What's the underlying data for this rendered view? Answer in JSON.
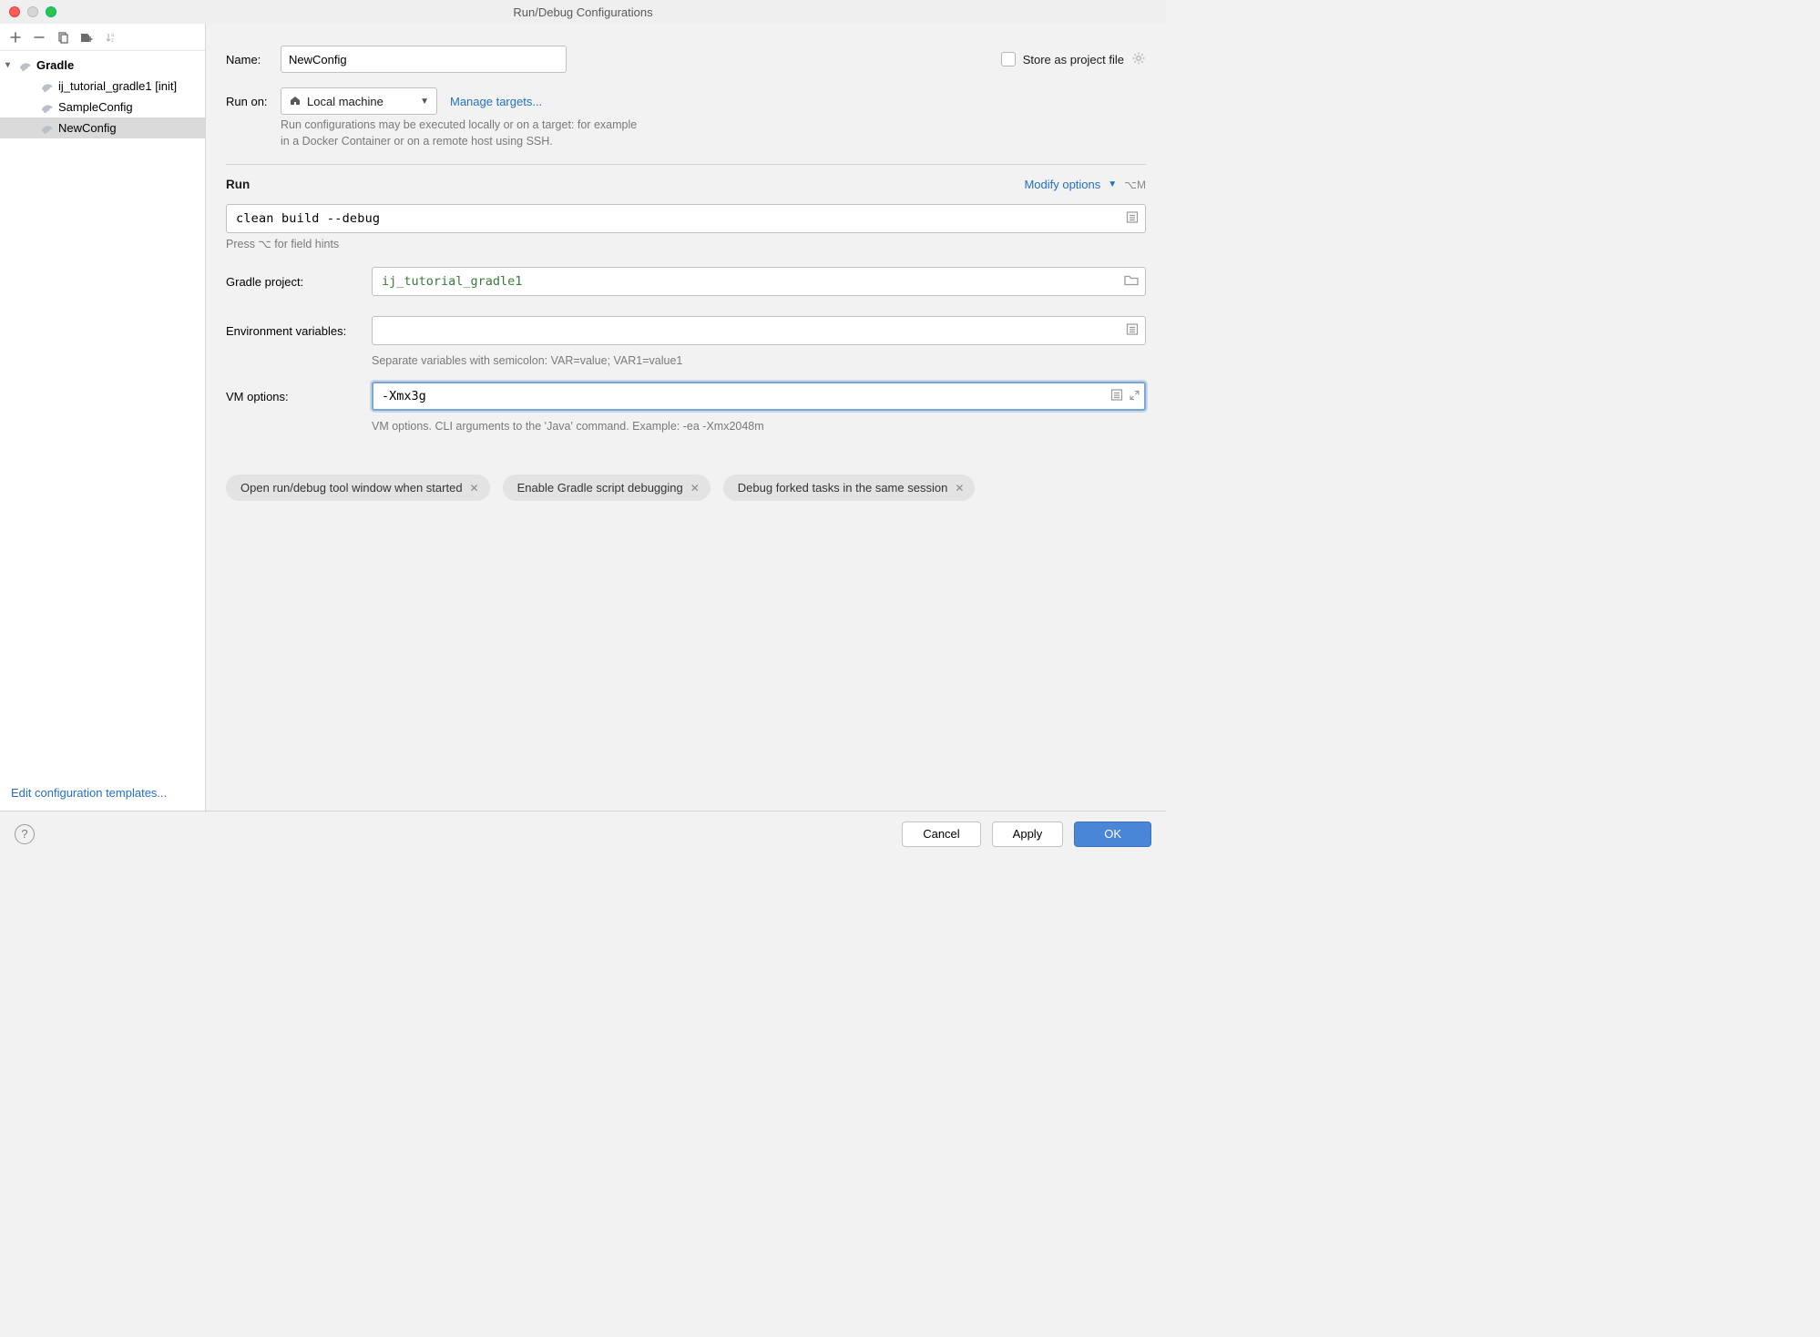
{
  "window": {
    "title": "Run/Debug Configurations"
  },
  "sidebar": {
    "toolbar_icons": [
      "add",
      "remove",
      "copy",
      "save",
      "sort"
    ],
    "group_label": "Gradle",
    "items": [
      {
        "label": "ij_tutorial_gradle1 [init]"
      },
      {
        "label": "SampleConfig"
      },
      {
        "label": "NewConfig"
      }
    ],
    "edit_templates_label": "Edit configuration templates..."
  },
  "form": {
    "name_label": "Name:",
    "name_value": "NewConfig",
    "store_label": "Store as project file",
    "runon_label": "Run on:",
    "runon_value": "Local machine",
    "manage_targets_label": "Manage targets...",
    "runon_hint_1": "Run configurations may be executed locally or on a target: for example",
    "runon_hint_2": "in a Docker Container or on a remote host using SSH."
  },
  "run": {
    "section_title": "Run",
    "modify_label": "Modify options",
    "modify_shortcut": "⌥M",
    "command_value": "clean build --debug",
    "command_hint": "Press ⌥ for field hints",
    "gradle_project_label": "Gradle project:",
    "gradle_project_value": "ij_tutorial_gradle1",
    "env_label": "Environment variables:",
    "env_value": "",
    "env_hint": "Separate variables with semicolon: VAR=value; VAR1=value1",
    "vm_label": "VM options:",
    "vm_value": "-Xmx3g",
    "vm_hint": "VM options. CLI arguments to the 'Java' command. Example: -ea -Xmx2048m"
  },
  "chips": [
    "Open run/debug tool window when started",
    "Enable Gradle script debugging",
    "Debug forked tasks in the same session"
  ],
  "buttons": {
    "cancel": "Cancel",
    "apply": "Apply",
    "ok": "OK"
  }
}
